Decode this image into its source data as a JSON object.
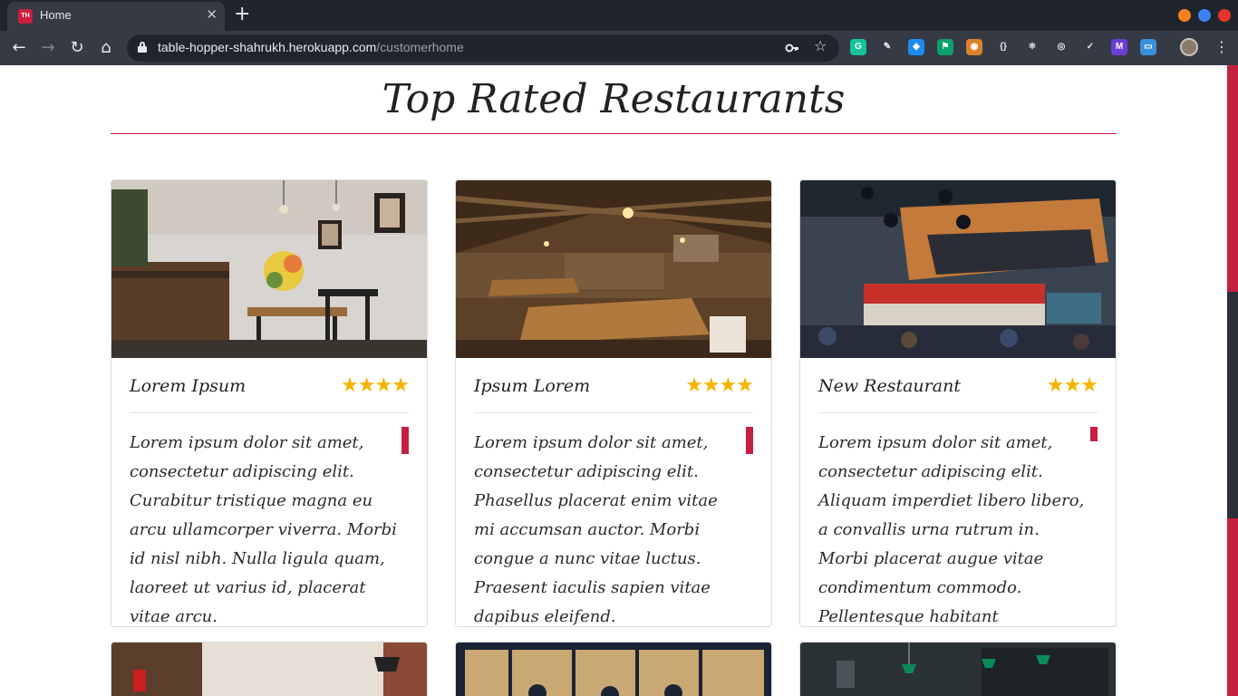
{
  "browser": {
    "tab": {
      "favicon_text": "TH",
      "title": "Home",
      "close_glyph": "✕"
    },
    "new_tab_glyph": "+",
    "nav": {
      "back": "←",
      "forward": "→",
      "reload": "↻",
      "home": "⌂"
    },
    "address": {
      "host": "table-hopper-shahrukh.herokuapp.com",
      "path": "/customerhome"
    },
    "omnibox_icons": {
      "key": "key-icon",
      "star": "☆"
    },
    "window_controls": {
      "minimize": "#f4831f",
      "maximize": "#3b82f6",
      "close": "#e5342b"
    },
    "extensions": [
      {
        "name": "grammarly-icon",
        "glyph": "G",
        "color": "#15c39a"
      },
      {
        "name": "pen-tool-icon",
        "glyph": "✎",
        "color": "#4a4f58"
      },
      {
        "name": "ethereum-icon",
        "glyph": "◆",
        "color": "#1c8cf0"
      },
      {
        "name": "flag-icon",
        "glyph": "⚑",
        "color": "#0aa06e"
      },
      {
        "name": "owl-icon",
        "glyph": "◉",
        "color": "#d9822b"
      },
      {
        "name": "code-braces-icon",
        "glyph": "{}",
        "color": "#4a4f58"
      },
      {
        "name": "react-icon",
        "glyph": "⚛",
        "color": "#4a4f58"
      },
      {
        "name": "target-icon",
        "glyph": "◎",
        "color": "#4a4f58"
      },
      {
        "name": "chart-icon",
        "glyph": "✓",
        "color": "#e8eaed"
      },
      {
        "name": "m-logo-icon",
        "glyph": "M",
        "color": "#6b3fd6"
      },
      {
        "name": "window-icon",
        "glyph": "▭",
        "color": "#3a8fd9"
      }
    ],
    "accent": "#c5203f"
  },
  "page": {
    "title": "Top Rated Restaurants",
    "restaurants": [
      {
        "name": "Lorem Ipsum",
        "rating": 4,
        "stars": "★★★★",
        "description": "Lorem ipsum dolor sit amet, consectetur adipiscing elit. Curabitur tristique magna eu arcu ullamcorper viverra. Morbi id nisl nibh. Nulla ligula quam, laoreet ut varius id, placerat vitae arcu.",
        "image_alt": "cafe interior with bar and flowers"
      },
      {
        "name": "Ipsum Lorem",
        "rating": 4,
        "stars": "★★★★",
        "description": "Lorem ipsum dolor sit amet, consectetur adipiscing elit. Phasellus placerat enim vitae mi accumsan auctor. Morbi congue a nunc vitae luctus. Praesent iaculis sapien vitae dapibus eleifend.",
        "image_alt": "rustic wooden dining hall"
      },
      {
        "name": "New Restaurant",
        "rating": 3,
        "stars": "★★★",
        "description": "Lorem ipsum dolor sit amet, consectetur adipiscing elit. Aliquam imperdiet libero libero, a convallis urna rutrum in. Morbi placerat augue vitae condimentum commodo. Pellentesque habitant",
        "image_alt": "busy modern restaurant with red sign"
      }
    ]
  }
}
